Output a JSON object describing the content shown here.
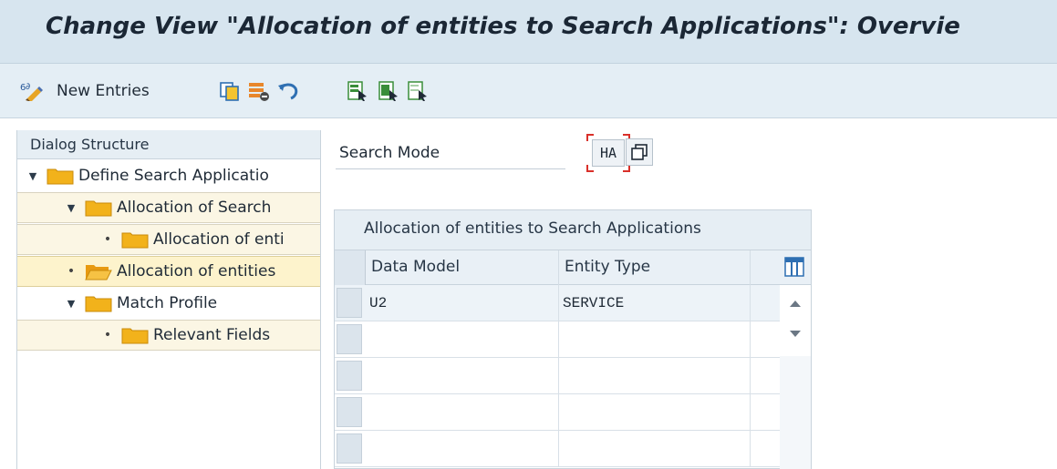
{
  "window": {
    "title": "Change View \"Allocation of entities to Search Applications\": Overvie"
  },
  "toolbar": {
    "new_entries_label": "New Entries",
    "icons": [
      "display-change-icon",
      "copy-as-icon",
      "delete-icon",
      "undo-change-icon",
      "select-all-icon",
      "select-block-icon",
      "deselect-all-icon"
    ]
  },
  "dialog_structure": {
    "header": "Dialog Structure",
    "items": [
      {
        "label": "Define Search Applicatio",
        "level": 0,
        "expanded": true
      },
      {
        "label": "Allocation of Search ",
        "level": 1,
        "expanded": true
      },
      {
        "label": "Allocation of enti",
        "level": 2,
        "leaf": true
      },
      {
        "label": "Allocation of entities",
        "level": 0,
        "leaf": true,
        "selected": true
      },
      {
        "label": "Match Profile",
        "level": 0,
        "expanded": true
      },
      {
        "label": "Relevant Fields",
        "level": 2,
        "leaf": true
      }
    ]
  },
  "search_mode": {
    "label": "Search Mode",
    "value": "HA"
  },
  "table": {
    "title": "Allocation of entities to Search Applications",
    "columns": [
      "Data Model",
      "Entity Type"
    ],
    "rows": [
      [
        "U2",
        "SERVICE"
      ],
      [
        "",
        ""
      ],
      [
        "",
        ""
      ],
      [
        "",
        ""
      ],
      [
        "",
        ""
      ]
    ]
  },
  "colors": {
    "title_bar": "#d7e5ef",
    "toolbar": "#e4eef5",
    "folder": "#f2b21b",
    "selected_row": "#fdf3cc",
    "focus_marker": "#d9302a"
  }
}
